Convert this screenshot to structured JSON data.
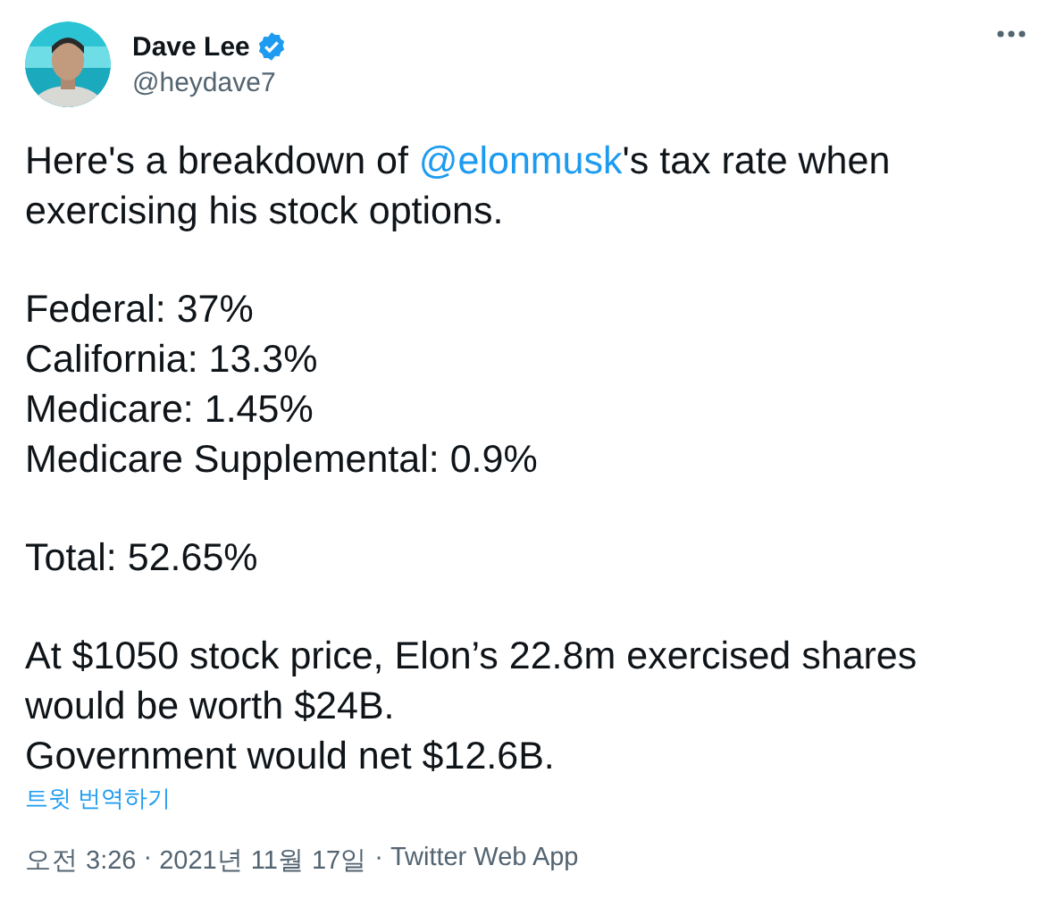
{
  "author": {
    "name": "Dave Lee",
    "verified": true,
    "handle": "@heydave7"
  },
  "paragraphs": [
    {
      "segments": [
        {
          "kind": "text",
          "text": "Here's a breakdown of "
        },
        {
          "kind": "mention",
          "text": "@elonmusk"
        },
        {
          "kind": "text",
          "text": "'s tax rate when\nexercising his stock options."
        }
      ]
    },
    {
      "segments": [
        {
          "kind": "text",
          "text": "Federal: 37%\nCalifornia: 13.3%\nMedicare: 1.45%\nMedicare Supplemental: 0.9%"
        }
      ]
    },
    {
      "segments": [
        {
          "kind": "text",
          "text": "Total: 52.65%"
        }
      ]
    },
    {
      "segments": [
        {
          "kind": "text",
          "text": "At $1050 stock price, Elon’s 22.8m exercised shares\nwould be worth $24B.\nGovernment would net $12.6B."
        }
      ]
    }
  ],
  "translate_link": "트윗 번역하기",
  "meta": {
    "time": "오전 3:26",
    "separator_1": "·",
    "date": "2021년 11월 17일",
    "separator_2": "·",
    "source": "Twitter Web App"
  }
}
